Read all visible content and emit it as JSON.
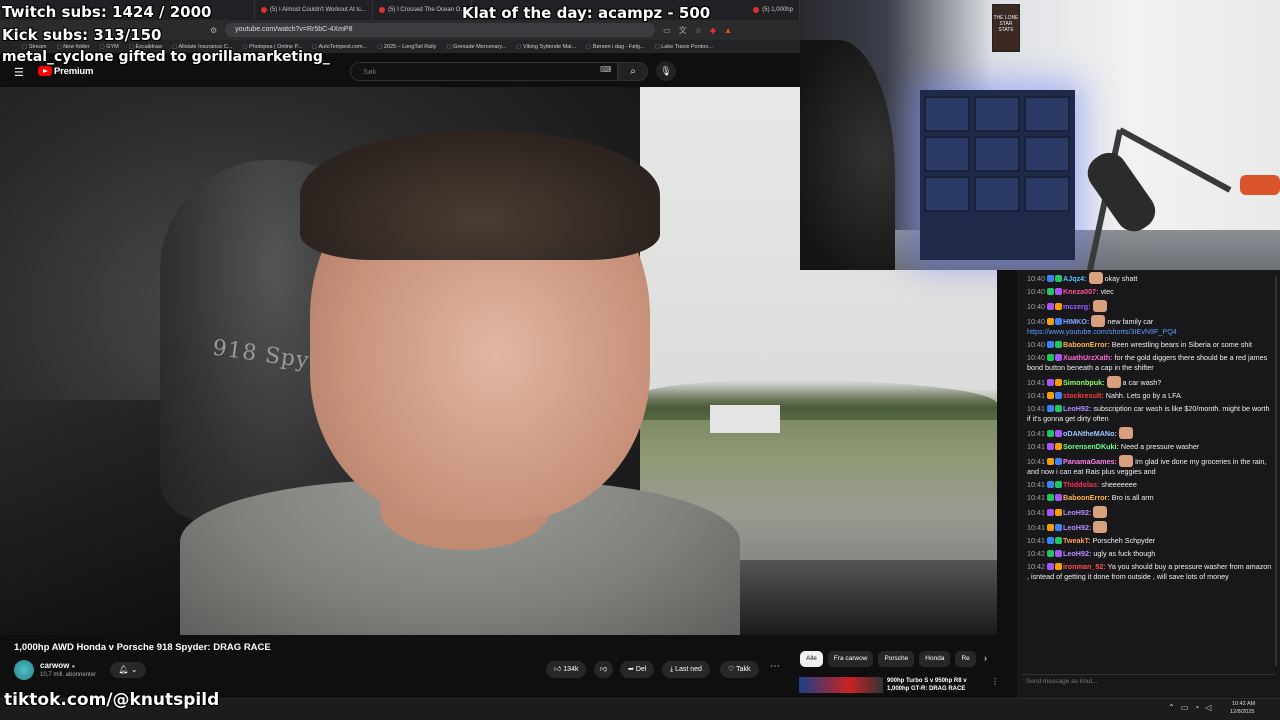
{
  "browser": {
    "tabs": [
      "(5) I Almost Couldn't Workout At Ic...",
      "(5) I Crossed The Ocean O...",
      "(5) 1,000hp"
    ],
    "url": "youtube.com/watch?v=Rr5bC-4XmP8",
    "bookmarks": [
      "Stream",
      "New folder",
      "GYM",
      "Excalidraw",
      "Allstate Insurance C...",
      "Photopea | Online P...",
      "AutoTempest.com...",
      "2025 – LongTail Rally",
      "Grenade Mercenary...",
      "Viking Syttende Mai...",
      "Børsen i dag - Følg...",
      "Lake Travis Pontoo..."
    ]
  },
  "youtube": {
    "logo_text": "Premium",
    "search_placeholder": "Søk",
    "video_seat_text": "918 Spyder",
    "video_title": "1,000hp AWD Honda v Porsche 918 Spyder: DRAG RACE",
    "channel_name": "carwow",
    "channel_subs": "10,7 mill. abonnenter",
    "likes": "134k",
    "share_label": "Del",
    "download_label": "Last ned",
    "thanks_label": "Takk",
    "chips": [
      "Alle",
      "Fra carwow",
      "Porsche",
      "Honda",
      "Re"
    ],
    "suggestion_title": "900hp Turbo S v 950hp R8 v 1,000hp GT-R: DRAG RACE"
  },
  "overlay": {
    "twitch_subs": "Twitch subs: 1424 / 2000",
    "kick_subs": "Kick subs: 313/150",
    "gift": "metal_cyclone gifted to gorillamarketing_",
    "klat": "Klat of the day: acampz - 500",
    "tiktok": "tiktok.com/@knutspild"
  },
  "webcam": {
    "poster_text": "THE LONE STAR STATE"
  },
  "chat": {
    "input_placeholder": "Send message as knut...",
    "messages": [
      {
        "time": "10:40",
        "user": "AJqz4:",
        "color": "#4dc3ff",
        "text": "okay shatt",
        "emote": true
      },
      {
        "time": "10:40",
        "user": "Kneza007:",
        "color": "#ff4f9a",
        "text": "vtec",
        "emote": false
      },
      {
        "time": "10:40",
        "user": "mczerg:",
        "color": "#9b59ff",
        "text": "",
        "emote": true
      },
      {
        "time": "10:40",
        "user": "HIMKO:",
        "color": "#7fa8ff",
        "text": "new family car",
        "emote": true,
        "link": "https://www.youtube.com/shorts/3IEvN9F_PQ4"
      },
      {
        "time": "10:40",
        "user": "BaboonError:",
        "color": "#ffb347",
        "text": "Been wrestling bears in Siberia or some shit",
        "emote": false
      },
      {
        "time": "10:40",
        "user": "XuathUrzXath:",
        "color": "#ff6bd5",
        "text": "for the gold diggers there should be a red james bond button beneath a cap in the shifter",
        "emote": false
      },
      {
        "time": "10:41",
        "user": "Simonbpuk:",
        "color": "#8cff5a",
        "text": "a car wash?",
        "emote": true
      },
      {
        "time": "10:41",
        "user": "stockresult:",
        "color": "#ff3b3b",
        "text": "Nahh. Lets go by a LFA",
        "emote": false
      },
      {
        "time": "10:41",
        "user": "LeoH92:",
        "color": "#b48cff",
        "text": "subscription car wash is like $20/month. might be worth if it's gonna get dirty often",
        "emote": false
      },
      {
        "time": "10:41",
        "user": "oDANtheMANo:",
        "color": "#9ec8ff",
        "text": "",
        "emote": true
      },
      {
        "time": "10:41",
        "user": "SorensenDKuki:",
        "color": "#6bff8f",
        "text": "Need a pressure washer",
        "emote": false
      },
      {
        "time": "10:41",
        "user": "PanamaGames:",
        "color": "#ff7de9",
        "text": "Im glad ive done my groceries in the rain, and now i can eat Rais plus veggies and",
        "emote": true
      },
      {
        "time": "10:41",
        "user": "Thiddolas:",
        "color": "#ff2f5a",
        "text": "sheeeeeee",
        "emote": false
      },
      {
        "time": "10:41",
        "user": "BaboonError:",
        "color": "#ffb347",
        "text": "Bro is all arm",
        "emote": false
      },
      {
        "time": "10:41",
        "user": "LeoH92:",
        "color": "#b48cff",
        "text": "",
        "emote": true
      },
      {
        "time": "10:41",
        "user": "LeoH92:",
        "color": "#b48cff",
        "text": "",
        "emote": true
      },
      {
        "time": "10:41",
        "user": "TweakT:",
        "color": "#ff9f5a",
        "text": "Porscheh Schpyder",
        "emote": false
      },
      {
        "time": "10:42",
        "user": "LeoH92:",
        "color": "#b48cff",
        "text": "ugly as fuck though",
        "emote": false
      },
      {
        "time": "10:42",
        "user": "ironman_52:",
        "color": "#ff4a4a",
        "text": "Ya you should buy a pressure washer from amazon , isntead of getting it done from outside , will save lots of money",
        "emote": false
      }
    ]
  },
  "taskbar": {
    "time": "10:42 AM",
    "date": "12/8/2025"
  },
  "colors": {
    "yt_red": "#ff0000",
    "chat_bg": "#18181b",
    "link": "#5d9cff"
  }
}
